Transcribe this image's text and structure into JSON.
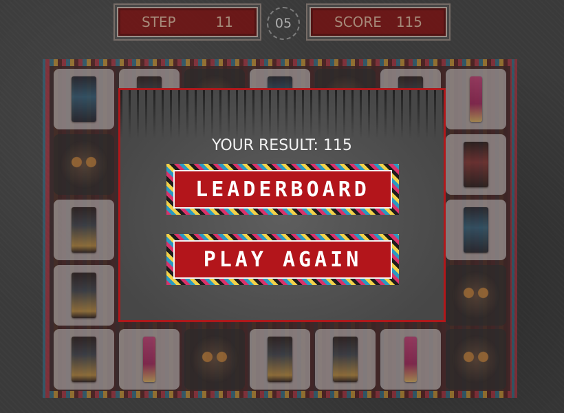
{
  "hud": {
    "step_label": "STEP",
    "step_value": "11",
    "timer": "05",
    "score_label": "SCORE",
    "score_value": "115"
  },
  "modal": {
    "result_text": "YOUR RESULT: 115",
    "leaderboard_label": "LEADERBOARD",
    "play_again_label": "PLAY AGAIN"
  },
  "colors": {
    "accent_red": "#b3151b",
    "modal_border": "#b0181b",
    "hud_bg": "#7a0d0d"
  },
  "icons": {
    "timer": "dashed-circle-timer-icon",
    "card_back": "owl-icon"
  }
}
